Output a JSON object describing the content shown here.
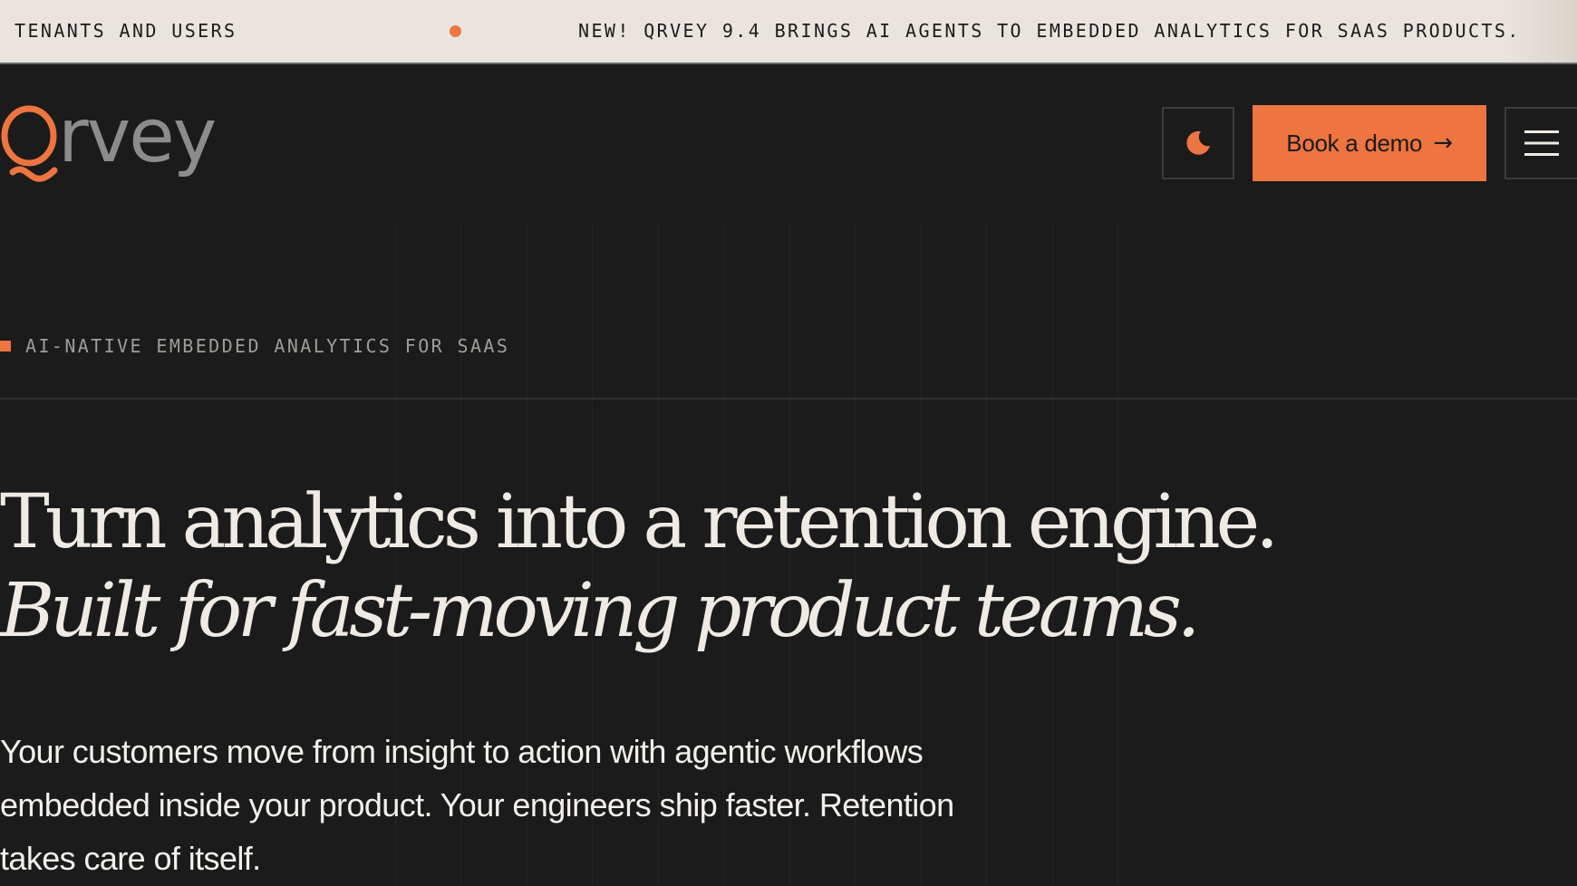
{
  "ticker": {
    "left_label": "TENANTS AND USERS",
    "announcement": "NEW! QRVEY 9.4 BRINGS AI AGENTS TO EMBEDDED ANALYTICS FOR SAAS PRODUCTS."
  },
  "header": {
    "logo_rest": "rvey",
    "demo_button": {
      "label": "Book a demo",
      "arrow": "→"
    },
    "theme_toggle_icon": "moon-icon",
    "menu_icon": "hamburger-menu-icon"
  },
  "hero": {
    "eyebrow": "AI-NATIVE EMBEDDED ANALYTICS FOR SAAS",
    "headline_line1": "Turn analytics into a retention engine.",
    "headline_line2": "Built for fast-moving product teams.",
    "subcopy": "Your customers move from insight to action with agentic workflows embedded inside your product. Your engineers ship faster. Retention takes care of itself."
  },
  "colors": {
    "accent": "#ee7440",
    "background": "#1b1b1b",
    "ticker_bg": "#e9e5de",
    "text_light": "#efebe4",
    "logo_gray": "#8c8c8c"
  }
}
